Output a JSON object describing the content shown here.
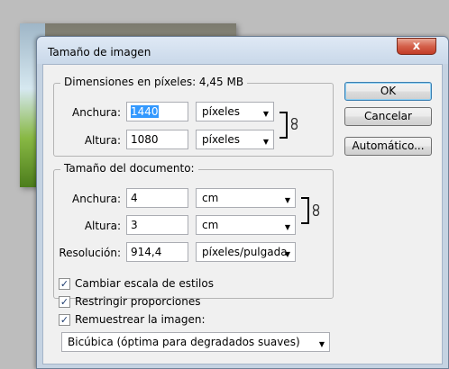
{
  "dialog": {
    "title": "Tamaño de imagen",
    "close_glyph": "x"
  },
  "pixel_dims": {
    "legend": "Dimensiones en píxeles: 4,45 MB",
    "width_label": "Anchura:",
    "width_value": "1440",
    "width_unit": "píxeles",
    "height_label": "Altura:",
    "height_value": "1080",
    "height_unit": "píxeles"
  },
  "doc_size": {
    "legend": "Tamaño del documento:",
    "width_label": "Anchura:",
    "width_value": "4",
    "width_unit": "cm",
    "height_label": "Altura:",
    "height_value": "3",
    "height_unit": "cm",
    "resolution_label": "Resolución:",
    "resolution_value": "914,4",
    "resolution_unit": "píxeles/pulgada"
  },
  "buttons": {
    "ok": "OK",
    "cancel": "Cancelar",
    "auto": "Automático..."
  },
  "options": {
    "scale_styles": {
      "label": "Cambiar escala de estilos",
      "checked": true
    },
    "constrain": {
      "label": "Restringir proporciones",
      "checked": true
    },
    "resample": {
      "label": "Remuestrear la imagen:",
      "checked": true
    },
    "method": "Bicúbica (óptima para degradados suaves)"
  },
  "icons": {
    "dropdown": "chevron-down-icon",
    "link": "chain-link-icon",
    "check": "checkmark-icon",
    "close": "close-icon"
  }
}
